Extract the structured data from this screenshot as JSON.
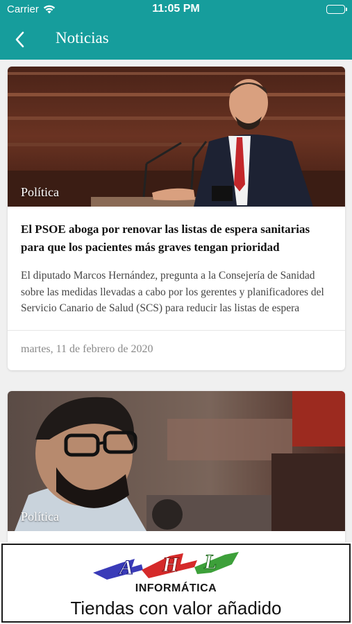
{
  "status_bar": {
    "carrier": "Carrier",
    "time": "11:05 PM",
    "wifi_icon": "wifi-icon",
    "battery_icon": "battery-icon"
  },
  "nav": {
    "back_icon": "chevron-left-icon",
    "title": "Noticias"
  },
  "articles": [
    {
      "category": "Política",
      "title": "El PSOE aboga por renovar las listas de espera sanitarias para que los pacientes más graves tengan prioridad",
      "summary": "El diputado Marcos Hernández, pregunta a la Consejería de Sanidad sobre las medidas llevadas a cabo por los gerentes y planificadores del Servicio Canario de Salud (SCS) para reducir las listas de espera",
      "date": "martes, 11 de febrero de 2020"
    },
    {
      "category": "Política"
    }
  ],
  "ad": {
    "logo_text": "AHL",
    "brand": "INFORMÁTICA",
    "tagline": "Tiendas con valor añadido"
  },
  "colors": {
    "header": "#169d9c",
    "background": "#f0f0f0"
  }
}
